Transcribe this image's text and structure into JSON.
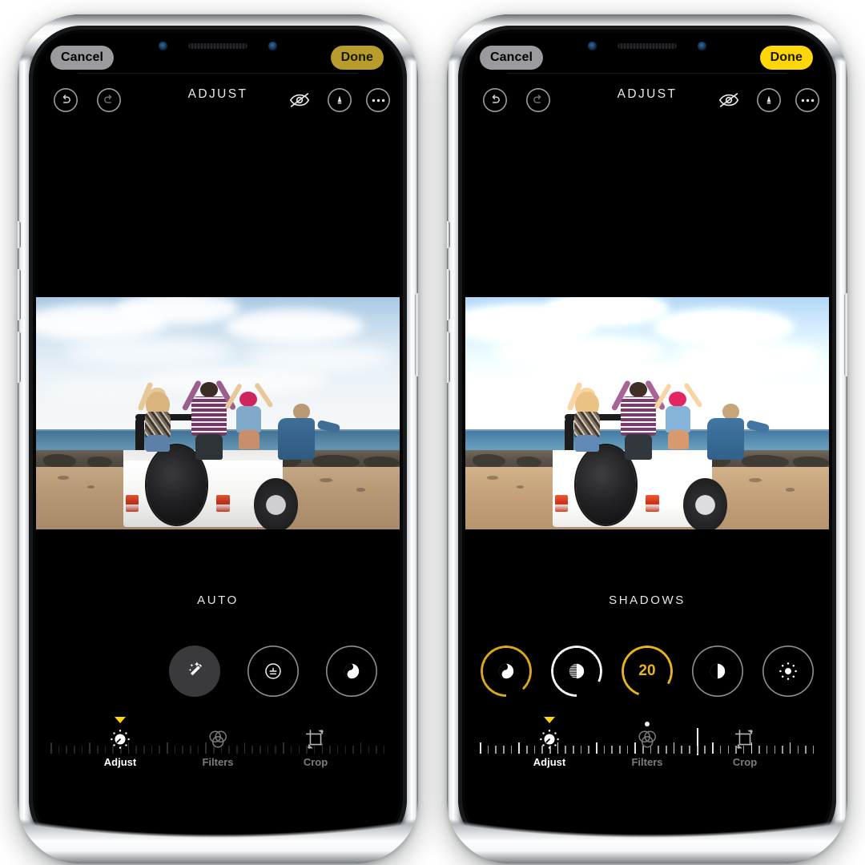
{
  "app": {
    "screen_name": "Photos Editor",
    "header_title": "ADJUST"
  },
  "phones": [
    {
      "id": "left",
      "cancel_label": "Cancel",
      "done_label": "Done",
      "done_state": "dim",
      "done_color": "#b89c2c",
      "header_title": "ADJUST",
      "toolbar_icons": [
        "undo-icon",
        "redo-icon",
        "hide-edits-icon",
        "markup-icon",
        "more-options-icon"
      ],
      "control_title": "AUTO",
      "dials": [
        {
          "name": "auto-magic-wand",
          "icon": "magic-wand-icon",
          "selected": true,
          "ring": "none",
          "ring_color": "#3a3a3c",
          "value": null,
          "progress": 0
        },
        {
          "name": "exposure",
          "icon": "exposure-icon",
          "selected": false,
          "ring": "gray",
          "ring_color": "#8e8e93",
          "value": null,
          "progress": 100
        },
        {
          "name": "brilliance",
          "icon": "brilliance-icon",
          "selected": false,
          "ring": "gray",
          "ring_color": "#8e8e93",
          "value": null,
          "progress": 100
        }
      ],
      "slider": {
        "active": false,
        "zero_pos_pct": 50,
        "cursor_pos_pct": 50,
        "tick_count": 45
      },
      "tabs": [
        {
          "name": "tab-adjust",
          "label": "Adjust",
          "icon": "adjust-dial-icon",
          "selected": true
        },
        {
          "name": "tab-filters",
          "label": "Filters",
          "icon": "filters-circles-icon",
          "selected": false
        },
        {
          "name": "tab-crop",
          "label": "Crop",
          "icon": "crop-rotate-icon",
          "selected": false
        }
      ]
    },
    {
      "id": "right",
      "cancel_label": "Cancel",
      "done_label": "Done",
      "done_state": "bright",
      "done_color": "#ffd60a",
      "header_title": "ADJUST",
      "toolbar_icons": [
        "undo-icon",
        "redo-icon",
        "hide-edits-icon",
        "markup-icon",
        "more-options-icon"
      ],
      "control_title": "SHADOWS",
      "dials": [
        {
          "name": "brilliance",
          "icon": "brilliance-icon",
          "selected": false,
          "ring": "yellow",
          "ring_color": "#d9a919",
          "value": null,
          "progress": 88
        },
        {
          "name": "highlights",
          "icon": "highlights-icon",
          "selected": false,
          "ring": "white",
          "ring_color": "#f2f2f4",
          "value": null,
          "progress": 82
        },
        {
          "name": "shadows",
          "icon": "value-label",
          "selected": true,
          "ring": "yellow",
          "ring_color": "#e8b41c",
          "value": "20",
          "value_color": "#e8b41c",
          "progress": 78
        },
        {
          "name": "contrast",
          "icon": "contrast-icon",
          "selected": false,
          "ring": "gray",
          "ring_color": "#8e8e93",
          "value": null,
          "progress": 100
        },
        {
          "name": "brightness",
          "icon": "brightness-icon",
          "selected": false,
          "ring": "gray",
          "ring_color": "#8e8e93",
          "value": null,
          "progress": 100
        }
      ],
      "slider": {
        "active": true,
        "zero_pos_pct": 50,
        "cursor_pos_pct": 65,
        "tick_count": 45,
        "value": "20"
      },
      "tabs": [
        {
          "name": "tab-adjust",
          "label": "Adjust",
          "icon": "adjust-dial-icon",
          "selected": true
        },
        {
          "name": "tab-filters",
          "label": "Filters",
          "icon": "filters-circles-icon",
          "selected": false
        },
        {
          "name": "tab-crop",
          "label": "Crop",
          "icon": "crop-rotate-icon",
          "selected": false
        }
      ]
    }
  ],
  "photo": {
    "description": "Four friends with arms raised standing in a white open-top Jeep parked on a rocky beach, ocean and cloudy sky behind",
    "colors": {
      "sky": "#d6e6f2",
      "sea": "#4d7e9f",
      "sand": "#bb9d79",
      "jeep": "#ffffff"
    }
  },
  "colors": {
    "accent_yellow": "#ffd60a",
    "accent_yellow_dim": "#b89c2c",
    "pill_gray": "#9a9a9f",
    "screen_black": "#000000",
    "label_gray": "#7d7d80"
  }
}
